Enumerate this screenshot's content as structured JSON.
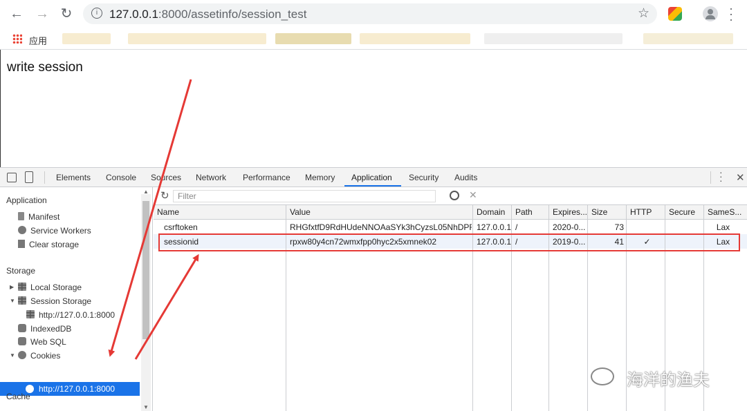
{
  "browser": {
    "url_host": "127.0.0.1",
    "url_rest": ":8000/assetinfo/session_test",
    "bookmarks_label": "应用"
  },
  "page": {
    "text": "write session"
  },
  "devtools": {
    "tabs": [
      "Elements",
      "Console",
      "Sources",
      "Network",
      "Performance",
      "Memory",
      "Application",
      "Security",
      "Audits"
    ],
    "active_tab": "Application",
    "filter_placeholder": "Filter",
    "sidebar": {
      "application_header": "Application",
      "manifest": "Manifest",
      "service_workers": "Service Workers",
      "clear_storage": "Clear storage",
      "storage_header": "Storage",
      "local_storage": "Local Storage",
      "session_storage": "Session Storage",
      "session_origin": "http://127.0.0.1:8000",
      "indexeddb": "IndexedDB",
      "websql": "Web SQL",
      "cookies": "Cookies",
      "cookies_origin": "http://127.0.0.1:8000",
      "cache_header": "Cache"
    },
    "columns": [
      "Name",
      "Value",
      "Domain",
      "Path",
      "Expires...",
      "Size",
      "HTTP",
      "Secure",
      "SameS..."
    ],
    "rows": [
      {
        "name": "csrftoken",
        "value": "RHGfxtfD9RdHUdeNNOAaSYk3hCyzsL05NhDPR...",
        "domain": "127.0.0.1",
        "path": "/",
        "expires": "2020-0...",
        "size": "73",
        "http": "",
        "secure": "",
        "samesite": "Lax"
      },
      {
        "name": "sessionid",
        "value": "rpxw80y4cn72wmxfpp0hyc2x5xmnek02",
        "domain": "127.0.0.1",
        "path": "/",
        "expires": "2019-0...",
        "size": "41",
        "http": "✓",
        "secure": "",
        "samesite": "Lax"
      }
    ]
  },
  "watermark": "海洋的渔夫",
  "colors": {
    "highlight": "#e53935",
    "accent": "#1a73e8"
  }
}
